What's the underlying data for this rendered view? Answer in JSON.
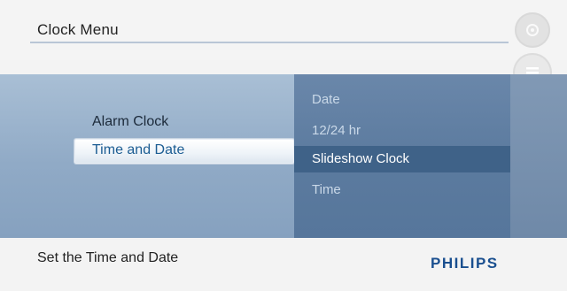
{
  "header": {
    "title": "Clock Menu"
  },
  "side_icons": [
    {
      "name": "settings-icon"
    },
    {
      "name": "menu-icon"
    },
    {
      "name": "power-icon"
    }
  ],
  "menu": {
    "items": [
      {
        "label": "Alarm Clock",
        "selected": false
      },
      {
        "label": "Time and Date",
        "selected": true
      }
    ]
  },
  "submenu": {
    "items": [
      {
        "label": "Date",
        "highlighted": false
      },
      {
        "label": "12/24 hr",
        "highlighted": false
      },
      {
        "label": "Slideshow Clock",
        "highlighted": true
      },
      {
        "label": "Time",
        "highlighted": false
      }
    ]
  },
  "footer": {
    "status": "Set the Time and Date",
    "brand": "PHILIPS"
  },
  "colors": {
    "brand": "#1a4f8f",
    "panel": "#90aac6",
    "submenu": "#5c7b9f",
    "highlight": "#3f6288"
  }
}
